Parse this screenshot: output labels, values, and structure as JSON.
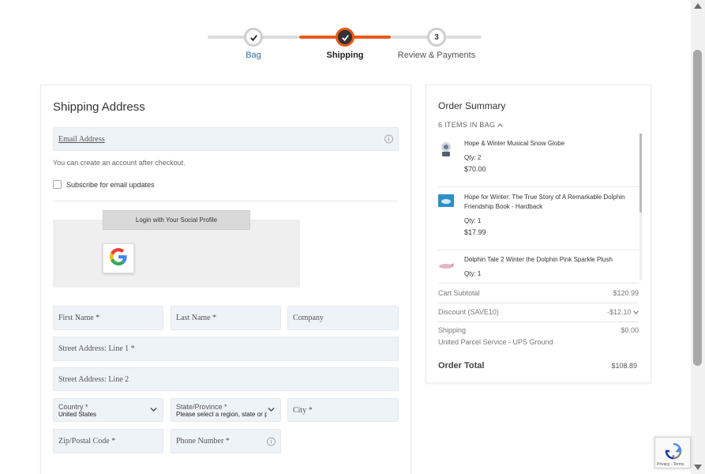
{
  "stepper": {
    "steps": [
      {
        "label": "Bag",
        "state": "done"
      },
      {
        "label": "Shipping",
        "state": "active"
      },
      {
        "label": "Review & Payments",
        "state": "todo",
        "number": "3"
      }
    ],
    "accent_color": "#e8591a"
  },
  "shipping": {
    "title": "Shipping Address",
    "email_placeholder": "Email Address",
    "account_hint": "You can create an account after checkout.",
    "subscribe_label": "Subscribe for email updates",
    "social_login_label": "Login with Your Social Profile",
    "first_name": "First Name *",
    "last_name": "Last Name *",
    "company": "Company",
    "street1": "Street Address: Line 1 *",
    "street2": "Street Address: Line 2",
    "country_label": "Country",
    "country_value": "United States",
    "state_label": "State/Province",
    "state_value": "Please select a region, state or prov",
    "city": "City *",
    "zip": "Zip/Postal Code *",
    "phone": "Phone Number *",
    "info_glyph": "i",
    "required_marker": "*"
  },
  "order_summary": {
    "title": "Order Summary",
    "items_count": "6 ITEMS IN BAG",
    "items": [
      {
        "name": "Hope & Winter Musical Snow Globe",
        "qty": "Qty: 2",
        "price": "$70.00"
      },
      {
        "name": "Hope for Winter: The True Story of A Remarkable Dolphin Friendship Book - Hardback",
        "qty": "Qty: 1",
        "price": "$17.99"
      },
      {
        "name": "Dolphin Tale 2 Winter the Dolphin Pink Sparkle Plush",
        "qty": "Qty: 1",
        "price": ""
      }
    ],
    "cart_subtotal_label": "Cart Subtotal",
    "cart_subtotal_value": "$120.99",
    "discount_label": "Discount (SAVE10)",
    "discount_value": "-$12.10",
    "shipping_label": "Shipping",
    "shipping_method": "United Parcel Service - UPS Ground",
    "shipping_value": "$0.00",
    "total_label": "Order Total",
    "total_value": "$108.89"
  },
  "recaptcha": {
    "text": "Privacy - Terms"
  }
}
